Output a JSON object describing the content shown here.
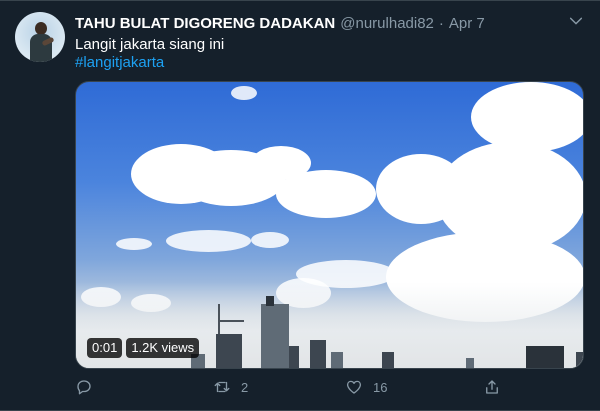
{
  "tweet": {
    "display_name": "TAHU BULAT DIGORENG DADAKAN",
    "handle": "@nurulhadi82",
    "separator": "·",
    "date": "Apr 7",
    "text": "Langit jakarta siang ini",
    "hashtag": "#langitjakarta"
  },
  "video": {
    "duration": "0:01",
    "views": "1.2K views"
  },
  "actions": {
    "reply_count": "",
    "retweet_count": "2",
    "like_count": "16"
  },
  "icons": {
    "caret": "chevron-down-icon",
    "reply": "reply-icon",
    "retweet": "retweet-icon",
    "like": "heart-icon",
    "share": "share-icon"
  },
  "colors": {
    "background": "#15202b",
    "text": "#ffffff",
    "muted": "#8899a6",
    "link": "#1da1f2",
    "border": "#38444d"
  }
}
